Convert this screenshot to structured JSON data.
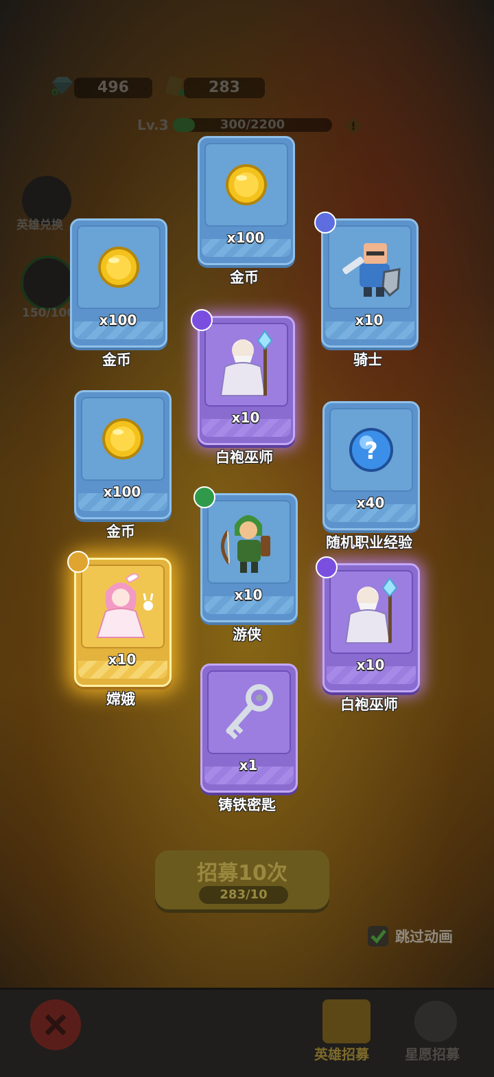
{
  "resources": {
    "gems": "496",
    "tickets": "283"
  },
  "level": {
    "label": "Lv.3",
    "xp_text": "300/2200",
    "xp_fraction": 0.136
  },
  "side": {
    "hero_exchange": "英雄兑换",
    "progress_text": "150/100"
  },
  "cards": [
    {
      "qty": "x100",
      "name": "金币",
      "rarity": "blue",
      "item": "coin"
    },
    {
      "qty": "x100",
      "name": "金币",
      "rarity": "blue",
      "item": "coin"
    },
    {
      "qty": "x10",
      "name": "骑士",
      "rarity": "blue",
      "item": "knight"
    },
    {
      "qty": "x10",
      "name": "白袍巫师",
      "rarity": "purple",
      "item": "wizard"
    },
    {
      "qty": "x100",
      "name": "金币",
      "rarity": "blue",
      "item": "coin"
    },
    {
      "qty": "x40",
      "name": "随机职业经验",
      "rarity": "blue",
      "item": "mystery"
    },
    {
      "qty": "x10",
      "name": "游侠",
      "rarity": "blue",
      "item": "ranger"
    },
    {
      "qty": "x10",
      "name": "嫦娥",
      "rarity": "gold",
      "item": "change"
    },
    {
      "qty": "x10",
      "name": "白袍巫师",
      "rarity": "purple",
      "item": "wizard"
    },
    {
      "qty": "x1",
      "name": "铸铁密匙",
      "rarity": "purple",
      "item": "key"
    }
  ],
  "recruit": {
    "label": "招募10次",
    "cost": "283/10"
  },
  "skip_animation": "跳过动画",
  "nav": {
    "hero_recruit": "英雄招募",
    "star_wish": "星愿招募"
  },
  "colors": {
    "blue_card": "#5c93cc",
    "purple_card": "#8a6cd0",
    "gold_card": "#e3b33d"
  }
}
